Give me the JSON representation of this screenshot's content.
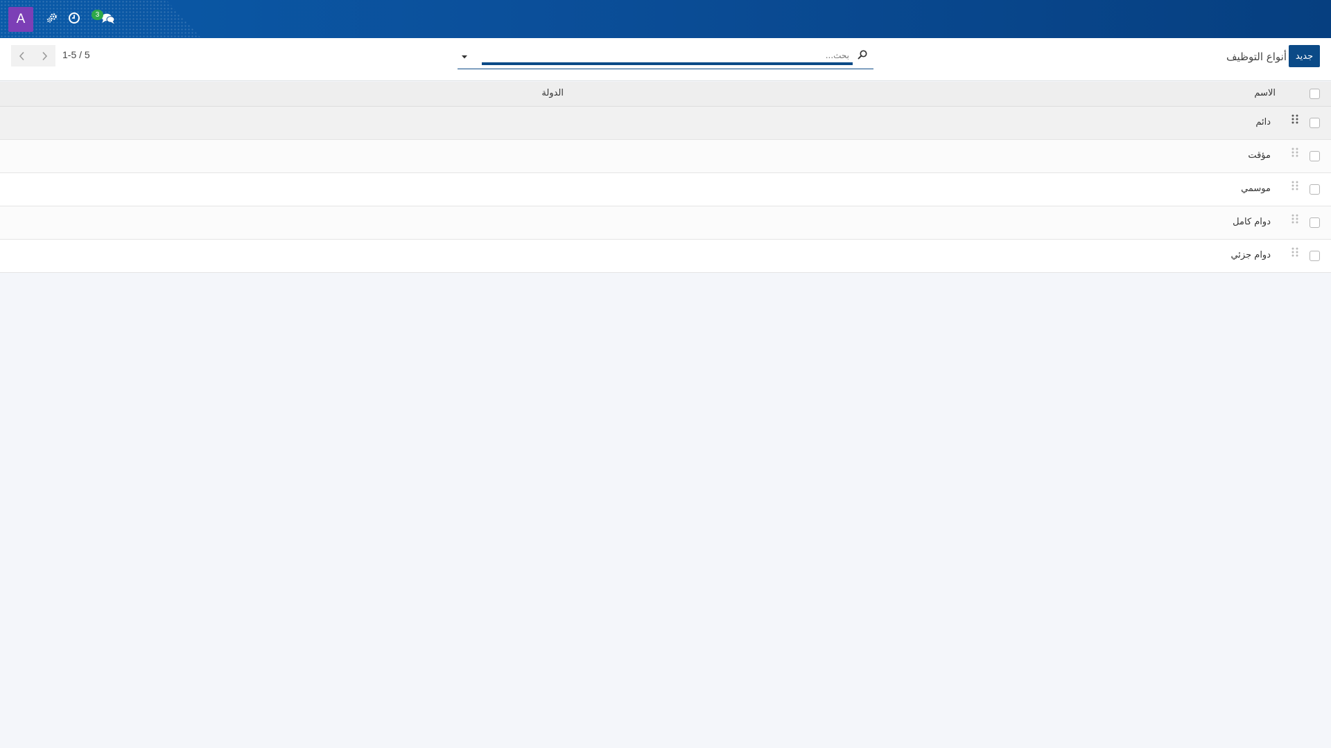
{
  "navbar": {
    "avatar_letter": "A",
    "icons": [
      "settings-gears-icon",
      "clock-icon",
      "chat-icon"
    ],
    "chat_badge": "3",
    "brand_color": "#0b4f9a"
  },
  "control_panel": {
    "new_button": "جديد",
    "title": "أنواع التوظيف",
    "search_placeholder": "بحث...",
    "pager": "1-5 / 5"
  },
  "table": {
    "columns": [
      "الاسم",
      "الدولة"
    ],
    "rows": [
      {
        "name": "دائم",
        "country": ""
      },
      {
        "name": "مؤقت",
        "country": ""
      },
      {
        "name": "موسمي",
        "country": ""
      },
      {
        "name": "دوام كامل",
        "country": ""
      },
      {
        "name": "دوام جزئي",
        "country": ""
      }
    ]
  }
}
